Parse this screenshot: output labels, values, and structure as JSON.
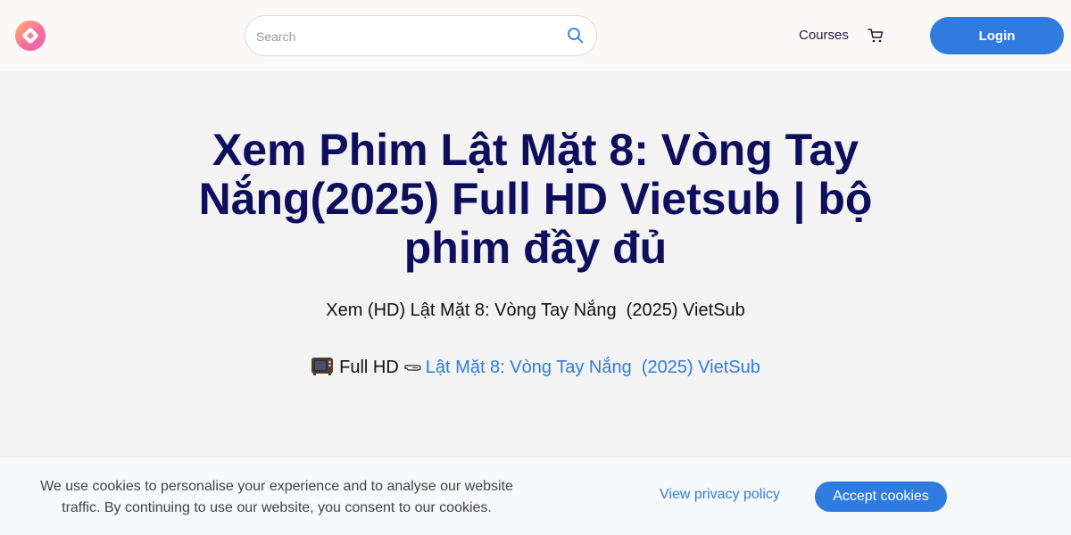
{
  "header": {
    "logo_icon": "logo-icon",
    "search": {
      "placeholder": "Search",
      "value": "",
      "icon": "search-icon"
    },
    "nav": {
      "courses_label": "Courses",
      "cart_icon": "cart-icon"
    },
    "login_label": "Login"
  },
  "main": {
    "title": "Xem Phim Lật Mặt 8: Vòng Tay Nắng(2025) Full HD Vietsub | bộ phim đầy đủ",
    "subtitle": "Xem (HD) Lật Mặt 8: Vòng Tay Nắng  (2025) VietSub",
    "fullhd": {
      "tv_icon": "tv-icon",
      "label": "Full HD",
      "arrow_icon": "pointing-hand-icon",
      "link_text": "Lật Mặt 8: Vòng Tay Nắng  (2025) VietSub"
    }
  },
  "cookie_banner": {
    "text": "We use cookies to personalise your experience and to analyse our website traffic. By continuing to use our website, you consent to our cookies.",
    "privacy_link": "View privacy policy",
    "accept_label": "Accept cookies"
  },
  "colors": {
    "accent": "#2f7be0",
    "title": "#0d0f5c",
    "page_background": "#f3f3f4",
    "header_background": "#fcf8f8"
  }
}
